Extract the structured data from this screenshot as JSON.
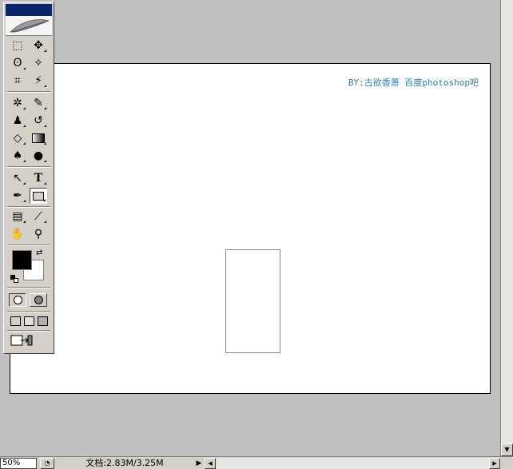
{
  "canvas": {
    "credit_text": "BY:古欲香萧  百度photoshop吧"
  },
  "toolbox": {
    "tools": [
      {
        "name": "rectangular-marquee-tool",
        "glyph": "⬚"
      },
      {
        "name": "move-tool",
        "glyph": "✥"
      },
      {
        "name": "lasso-tool",
        "glyph": "ʘ"
      },
      {
        "name": "magic-wand-tool",
        "glyph": "✧"
      },
      {
        "name": "crop-tool",
        "glyph": "⌗"
      },
      {
        "name": "slice-tool",
        "glyph": "⚡"
      },
      {
        "name": "healing-brush-tool",
        "glyph": "✲"
      },
      {
        "name": "brush-tool",
        "glyph": "✎"
      },
      {
        "name": "clone-stamp-tool",
        "glyph": "♟"
      },
      {
        "name": "history-brush-tool",
        "glyph": "↺"
      },
      {
        "name": "eraser-tool",
        "glyph": "◇"
      },
      {
        "name": "gradient-tool",
        "glyph": "▭"
      },
      {
        "name": "blur-tool",
        "glyph": "♠"
      },
      {
        "name": "dodge-tool",
        "glyph": "●"
      },
      {
        "name": "path-selection-tool",
        "glyph": "↖"
      },
      {
        "name": "type-tool",
        "glyph": "T"
      },
      {
        "name": "pen-tool",
        "glyph": "✒"
      },
      {
        "name": "rectangle-shape-tool",
        "glyph": "▭"
      },
      {
        "name": "notes-tool",
        "glyph": "▤"
      },
      {
        "name": "eyedropper-tool",
        "glyph": "⟋"
      },
      {
        "name": "hand-tool",
        "glyph": "✋"
      },
      {
        "name": "zoom-tool",
        "glyph": "⚲"
      }
    ],
    "foreground_color": "#000000",
    "background_color": "#ffffff"
  },
  "statusbar": {
    "zoom": "50%",
    "doc_info": "文档:2.83M/3.25M"
  }
}
